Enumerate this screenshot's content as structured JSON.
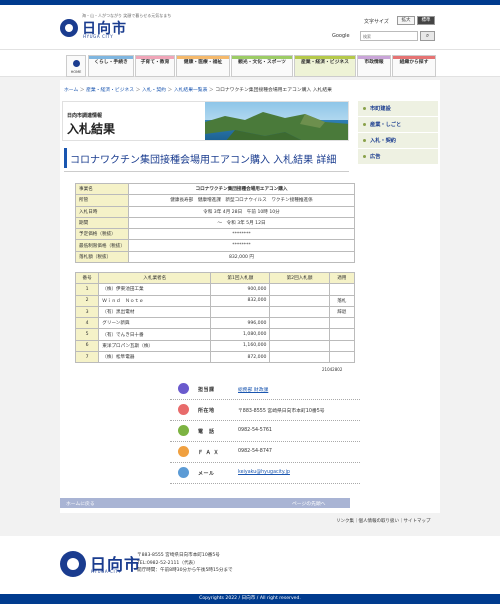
{
  "header": {
    "tagline": "海・山・人がつながり 笑顔で暮らせる元気なまち",
    "logo_name": "日向市",
    "logo_en": "HYUGA CITY",
    "font_size_label": "文字サイズ",
    "font_size_big": "拡大",
    "font_size_std": "標準",
    "search_label": "Google",
    "search_placeholder": "検索",
    "search_icon": "magnifier-icon"
  },
  "nav": {
    "home": "HOME",
    "items": [
      {
        "label": "くらし・手続き",
        "color": "#7fb6e0"
      },
      {
        "label": "子育て・教育",
        "color": "#f0a5b8"
      },
      {
        "label": "健康・医療・福祉",
        "color": "#f5b96b"
      },
      {
        "label": "観光・文化・スポーツ",
        "color": "#9ccc65"
      },
      {
        "label": "産業・経済・ビジネス",
        "color": "#b5c94a"
      },
      {
        "label": "市政情報",
        "color": "#c9a4d8"
      },
      {
        "label": "組織から探す",
        "color": "#e57373"
      }
    ]
  },
  "breadcrumb": {
    "items": [
      "ホーム",
      "産業・経済・ビジネス",
      "入札・契約",
      "入札結果一覧表"
    ],
    "current": "コロナワクチン集団接種会場用エアコン購入 入札結果"
  },
  "banner": {
    "subtitle": "日向市調達情報",
    "title": "入札結果"
  },
  "sidebar": {
    "items": [
      "市町建設",
      "産業・しごと",
      "入札・契約",
      "広告"
    ]
  },
  "page_title": "コロナワクチン集団接種会場用エアコン購入 入札結果 詳細",
  "summary": {
    "rows": [
      {
        "key": "事業名",
        "value": "コロナワクチン集団接種会場用エアコン購入"
      },
      {
        "key": "所管",
        "value": "健康長寿部　健康増進課　新型コロナウイルス　ワクチン接種推進係"
      },
      {
        "key": "入札日時",
        "value": "令和 3年 4月 28日　午前 10時 10分"
      },
      {
        "key": "期間",
        "value": "〜　令和 3年 5月 12日"
      },
      {
        "key": "予定価格（税抜）",
        "value": "********"
      },
      {
        "key": "最低制限価格（税抜）",
        "value": "********"
      },
      {
        "key": "落札額（税抜）",
        "value": "832,000 円"
      }
    ]
  },
  "bids": {
    "headers": [
      "番号",
      "入札業者名",
      "第1回入札額",
      "第2回入札額",
      "適用"
    ],
    "rows": [
      {
        "no": "1",
        "name": "（株）伊東池田工業",
        "p1": "900,000",
        "p2": "",
        "note": ""
      },
      {
        "no": "2",
        "name": "Ｗｉｎｄ　Ｎｏｔｅ",
        "p1": "832,000",
        "p2": "",
        "note": "落札"
      },
      {
        "no": "3",
        "name": "（有）黒出電材",
        "p1": "",
        "p2": "",
        "note": "辞退"
      },
      {
        "no": "4",
        "name": "グリーン新興",
        "p1": "996,000",
        "p2": "",
        "note": ""
      },
      {
        "no": "5",
        "name": "（有）でんき日十番",
        "p1": "1,080,000",
        "p2": "",
        "note": ""
      },
      {
        "no": "6",
        "name": "東洋プロパン瓦斯（株）",
        "p1": "1,160,000",
        "p2": "",
        "note": ""
      },
      {
        "no": "7",
        "name": "（株）松隼電器",
        "p1": "872,000",
        "p2": "",
        "note": ""
      }
    ]
  },
  "doc_number": "21042802",
  "contact": {
    "rows": [
      {
        "label": "担当課",
        "value": "総務部 財政課",
        "icon": "person-icon",
        "color": "#6a5acd",
        "link": true
      },
      {
        "label": "所在地",
        "value": "〒883-8555 宮崎県日向市本町10番5号",
        "icon": "location-pin-icon",
        "color": "#e86b6b",
        "link": false
      },
      {
        "label": "電　話",
        "value": "0982-54-5761",
        "icon": "phone-icon",
        "color": "#7cb342",
        "link": false
      },
      {
        "label": "Ｆ Ａ Ｘ",
        "value": "0982-54-8747",
        "icon": "fax-icon",
        "color": "#f0a040",
        "link": false
      },
      {
        "label": "メール",
        "value": "keiyaku@hyugacity.jp",
        "icon": "mail-icon",
        "color": "#5c9bd5",
        "link": true
      }
    ]
  },
  "pagebar": {
    "home": "ホームに戻る",
    "top": "ページの先頭へ"
  },
  "footer": {
    "links": "リンク集｜個人情報の取り扱い｜サイトマップ",
    "name": "日向市",
    "en": "HYUGA CITY",
    "address": "〒883-8555 宮崎県日向市本町10番5号",
    "tel": "TEL:0982-52-2111（代表）",
    "hours": "開庁時間：午前8時30分から午後5時15分まで",
    "copyright": "Copyrights 2022 / 日向市 / All right reserved."
  }
}
